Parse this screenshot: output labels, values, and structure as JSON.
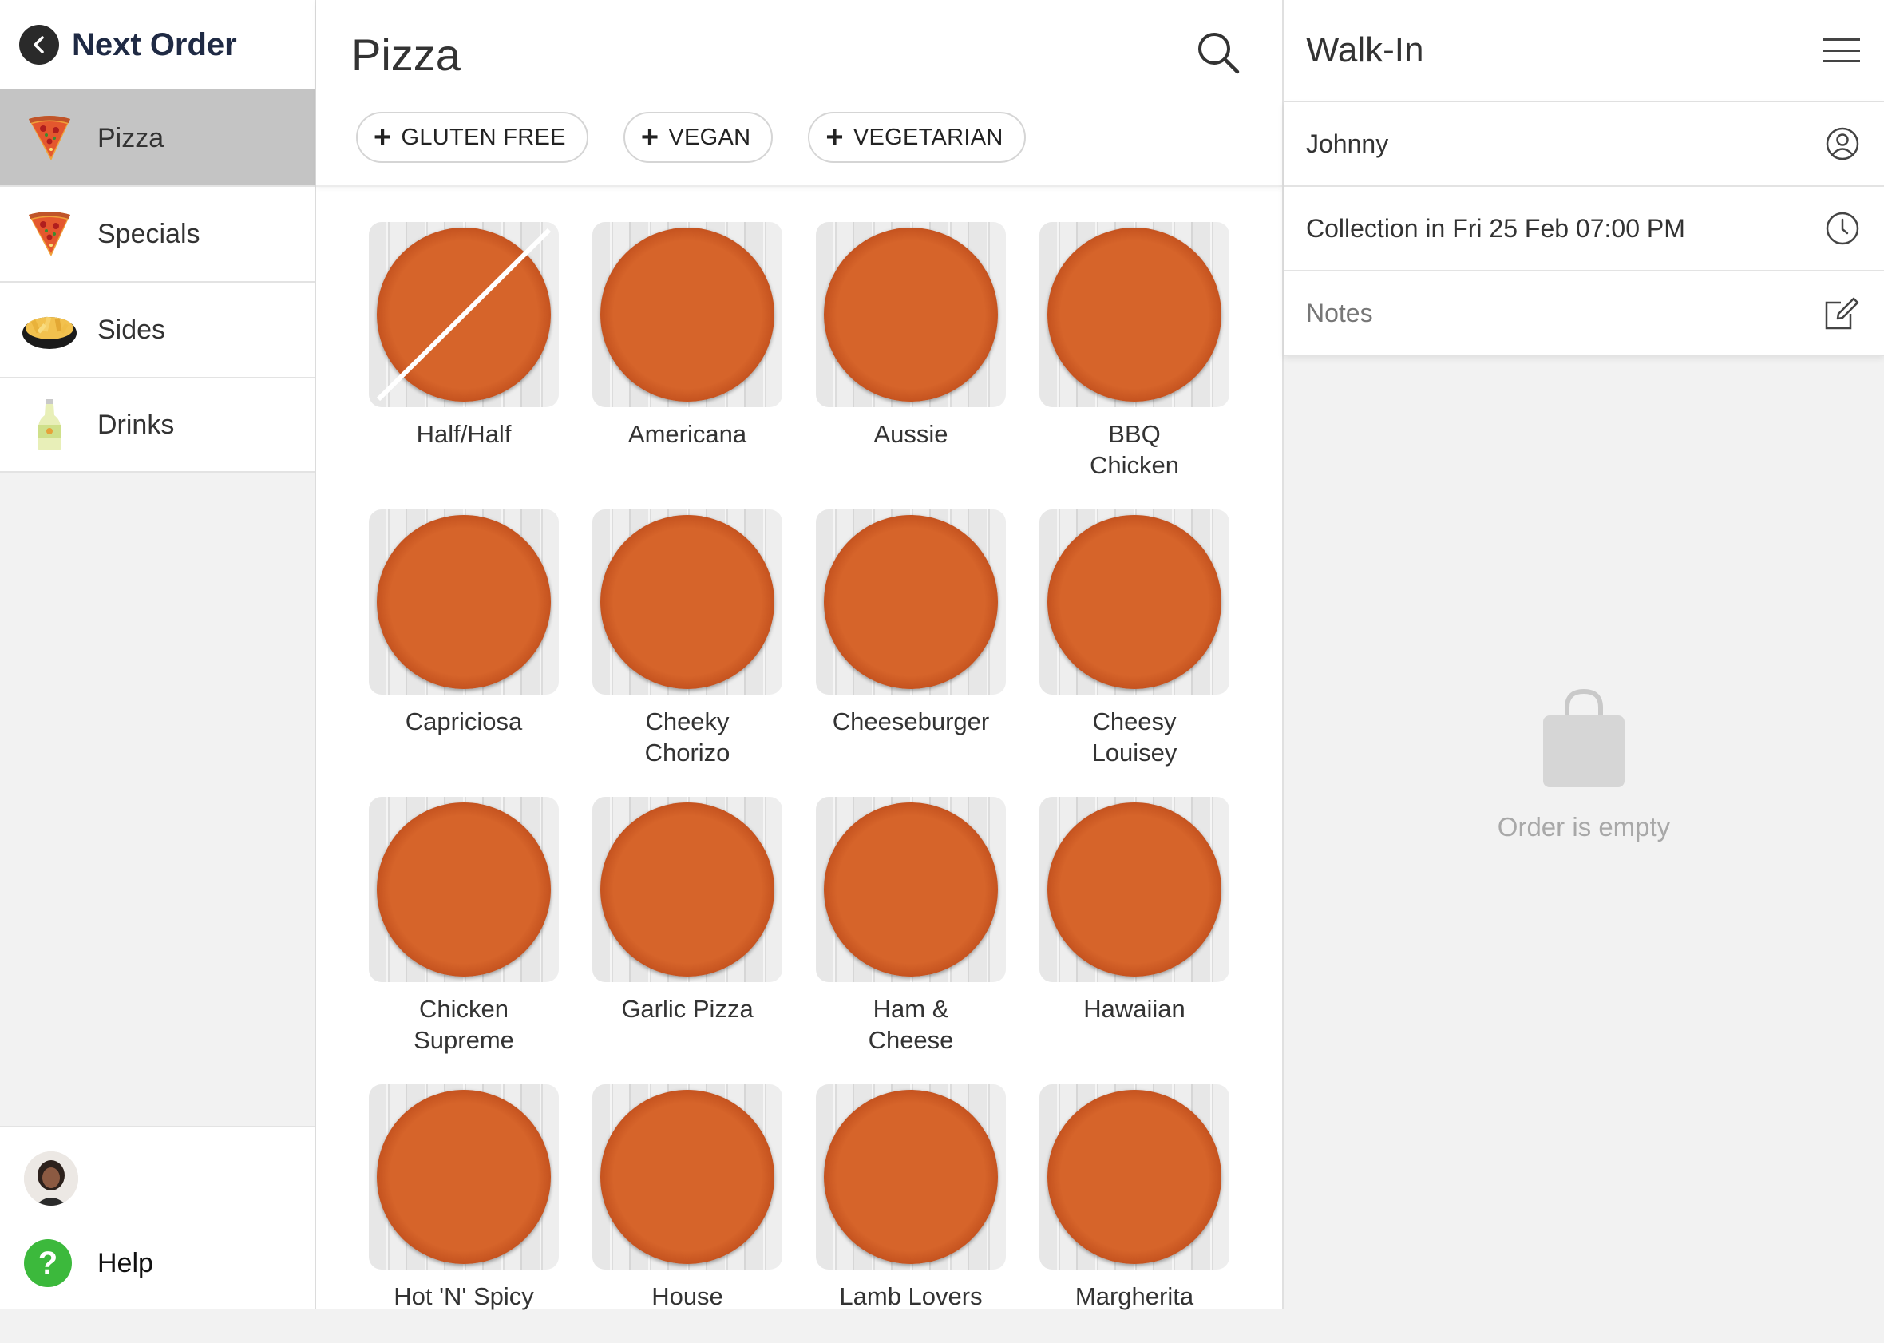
{
  "sidebar": {
    "title": "Next Order",
    "categories": [
      {
        "label": "Pizza",
        "icon": "pizza-slice-icon",
        "active": true
      },
      {
        "label": "Specials",
        "icon": "pizza-slice-icon",
        "active": false
      },
      {
        "label": "Sides",
        "icon": "fries-bowl-icon",
        "active": false
      },
      {
        "label": "Drinks",
        "icon": "bottle-icon",
        "active": false
      }
    ],
    "help_label": "Help"
  },
  "main": {
    "title": "Pizza",
    "filters": [
      "GLUTEN FREE",
      "VEGAN",
      "VEGETARIAN"
    ],
    "products": [
      {
        "name": "Half/Half"
      },
      {
        "name": "Americana"
      },
      {
        "name": "Aussie"
      },
      {
        "name": "BBQ\nChicken"
      },
      {
        "name": "Capriciosa"
      },
      {
        "name": "Cheeky\nChorizo"
      },
      {
        "name": "Cheeseburger"
      },
      {
        "name": "Cheesy\nLouisey"
      },
      {
        "name": "Chicken\nSupreme"
      },
      {
        "name": "Garlic Pizza"
      },
      {
        "name": "Ham &\nCheese"
      },
      {
        "name": "Hawaiian"
      },
      {
        "name": "Hot 'N' Spicy"
      },
      {
        "name": "House"
      },
      {
        "name": "Lamb Lovers"
      },
      {
        "name": "Margherita"
      }
    ]
  },
  "order": {
    "title": "Walk-In",
    "customer": "Johnny",
    "collection": "Collection in Fri 25 Feb 07:00 PM",
    "notes_placeholder": "Notes",
    "empty_text": "Order is empty"
  },
  "colors": {
    "active_category": "#c4c4c4",
    "help_green": "#3cb93c",
    "title_navy": "#1f2a44"
  }
}
